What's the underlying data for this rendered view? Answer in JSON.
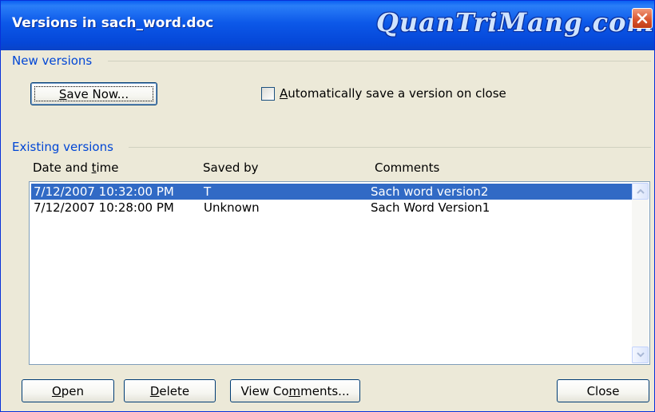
{
  "window": {
    "title": "Versions in sach_word.doc",
    "watermark": "QuanTriMang.com"
  },
  "new_versions": {
    "label": "New versions",
    "save_now": {
      "pre": "",
      "key": "S",
      "post": "ave Now..."
    },
    "auto_save": {
      "pre": "",
      "key": "A",
      "post": "utomatically save a version on close",
      "checked": false
    }
  },
  "existing_versions": {
    "label": "Existing versions",
    "columns": [
      {
        "pre": "Date and ",
        "key": "t",
        "post": "ime"
      },
      {
        "pre": "Saved by",
        "key": "",
        "post": ""
      },
      {
        "pre": "Comments",
        "key": "",
        "post": ""
      }
    ],
    "rows": [
      {
        "date": "7/12/2007 10:32:00 PM",
        "saved_by": "T",
        "comments": "Sach word version2",
        "selected": true
      },
      {
        "date": "7/12/2007 10:28:00 PM",
        "saved_by": "Unknown",
        "comments": "Sach Word Version1",
        "selected": false
      }
    ]
  },
  "buttons": {
    "open": {
      "pre": "",
      "key": "O",
      "post": "pen"
    },
    "delete": {
      "pre": "",
      "key": "D",
      "post": "elete"
    },
    "view_comments": {
      "pre": "View Co",
      "key": "m",
      "post": "ments..."
    },
    "close": {
      "pre": "Close",
      "key": "",
      "post": ""
    }
  },
  "colors": {
    "titlebar": "#0a53e4",
    "selection": "#316ac5",
    "group_label": "#0046d5",
    "dialog_bg": "#ece9d8"
  },
  "icons": {
    "close": "close-icon",
    "scroll_up": "chevron-up-icon",
    "scroll_down": "chevron-down-icon"
  }
}
